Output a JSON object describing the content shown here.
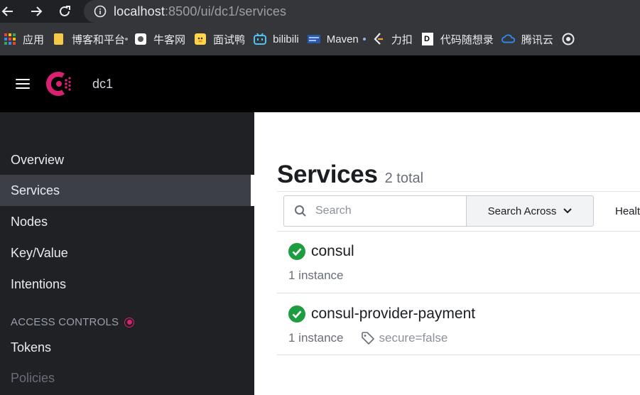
{
  "browser": {
    "url_host": "localhost",
    "url_rest": ":8500/ui/dc1/services",
    "bookmarks": [
      {
        "label": "应用",
        "icon": "apps-grid-icon"
      },
      {
        "label": "博客和平台",
        "icon": "folder-icon"
      },
      {
        "label": "牛客网",
        "icon": "nowcoder-icon"
      },
      {
        "label": "面试鸭",
        "icon": "duck-icon"
      },
      {
        "label": "bilibili",
        "icon": "bilibili-icon"
      },
      {
        "label": "Maven",
        "icon": "maven-icon"
      },
      {
        "label": "力扣",
        "icon": "leetcode-icon"
      },
      {
        "label": "代码随想录",
        "icon": "dmsxl-icon"
      },
      {
        "label": "腾讯云",
        "icon": "tencent-cloud-icon"
      }
    ]
  },
  "header": {
    "datacenter": "dc1"
  },
  "sidebar": {
    "items": [
      {
        "label": "Overview"
      },
      {
        "label": "Services"
      },
      {
        "label": "Nodes"
      },
      {
        "label": "Key/Value"
      },
      {
        "label": "Intentions"
      }
    ],
    "section_label": "ACCESS CONTROLS",
    "access_items": [
      {
        "label": "Tokens"
      },
      {
        "label": "Policies"
      }
    ]
  },
  "main": {
    "title": "Services",
    "count": "2 total",
    "search_placeholder": "Search",
    "search_across_label": "Search Across",
    "health_label": "Healt",
    "services": [
      {
        "name": "consul",
        "instances": "1 instance",
        "tag": ""
      },
      {
        "name": "consul-provider-payment",
        "instances": "1 instance",
        "tag": "secure=false"
      }
    ]
  },
  "colors": {
    "brand": "#d8226f",
    "passing": "#1d9d3f",
    "sidebar_bg": "#1f2125",
    "active_bg": "#3c3f47"
  }
}
